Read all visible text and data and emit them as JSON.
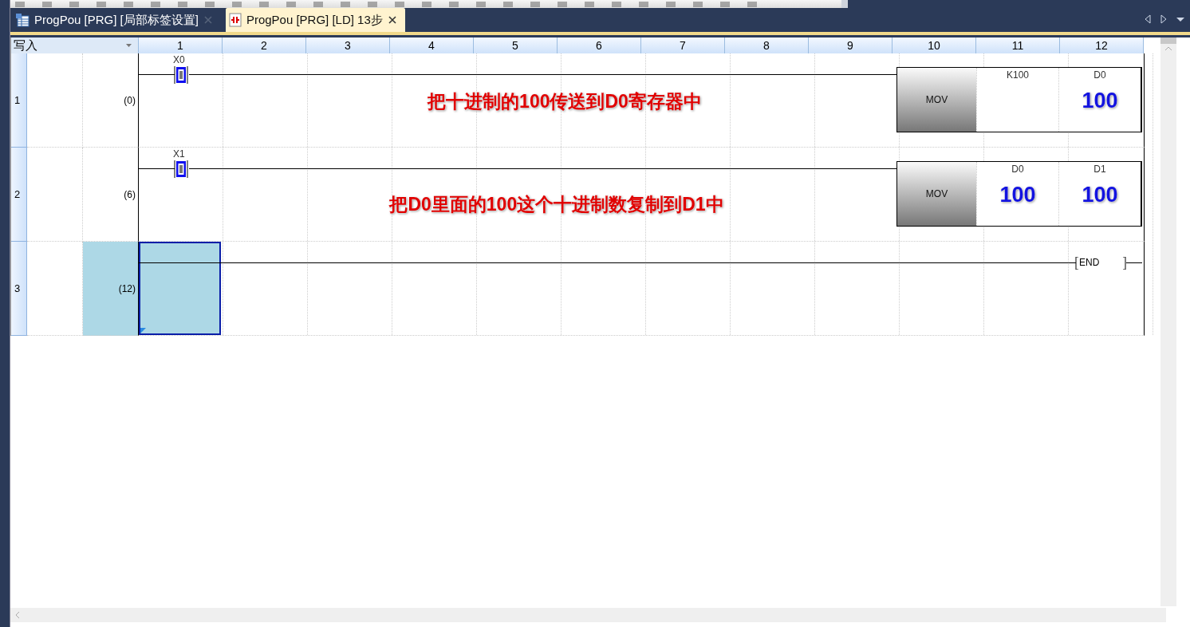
{
  "tabs": [
    {
      "label": "ProgPou [PRG] [局部标签设置]",
      "selected": false,
      "kind": "labels"
    },
    {
      "label": "ProgPou [PRG] [LD] 13步",
      "selected": true,
      "kind": "ladder"
    }
  ],
  "grid": {
    "mode_label": "写入",
    "columns": [
      "1",
      "2",
      "3",
      "4",
      "5",
      "6",
      "7",
      "8",
      "9",
      "10",
      "11",
      "12"
    ]
  },
  "rungs": [
    {
      "row": "1",
      "step": "(0)",
      "selected": false,
      "kind": "mov",
      "contact": "X0",
      "instruction": "MOV",
      "operands": [
        {
          "label": "K100"
        },
        {
          "label": "D0",
          "value": "100"
        }
      ],
      "annotation": "把十进制的100传送到D0寄存器中"
    },
    {
      "row": "2",
      "step": "(6)",
      "selected": false,
      "kind": "mov",
      "contact": "X1",
      "instruction": "MOV",
      "operands": [
        {
          "label": "D0",
          "value": "100"
        },
        {
          "label": "D1",
          "value": "100"
        }
      ],
      "annotation": "把D0里面的100这个十进制数复制到D1中"
    },
    {
      "row": "3",
      "step": "(12)",
      "selected": true,
      "kind": "end",
      "instruction": "END"
    }
  ]
}
